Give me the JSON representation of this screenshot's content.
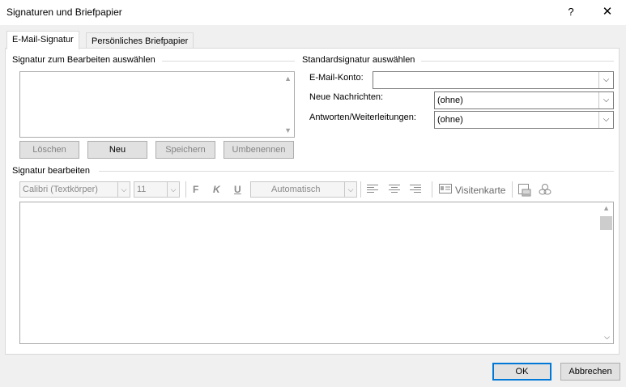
{
  "window": {
    "title": "Signaturen und Briefpapier",
    "help": "?",
    "close": "✕"
  },
  "tabs": [
    {
      "label": "E-Mail-Signatur",
      "active": true
    },
    {
      "label": "Persönliches Briefpapier",
      "active": false
    }
  ],
  "select_signature": {
    "label": "Signatur zum Bearbeiten auswählen",
    "buttons": {
      "delete": "Löschen",
      "new": "Neu",
      "save": "Speichern",
      "rename": "Umbenennen"
    }
  },
  "default_signature": {
    "label": "Standardsignatur auswählen",
    "account_label": "E-Mail-Konto:",
    "account_value": "",
    "new_messages_label": "Neue Nachrichten:",
    "new_messages_value": "(ohne)",
    "replies_label": "Antworten/Weiterleitungen:",
    "replies_value": "(ohne)"
  },
  "edit_signature": {
    "label": "Signatur bearbeiten",
    "font_value": "Calibri (Textkörper)",
    "size_value": "11",
    "bold": "F",
    "italic": "K",
    "underline": "U",
    "color_value": "Automatisch",
    "business_card": "Visitenkarte"
  },
  "footer": {
    "ok": "OK",
    "cancel": "Abbrechen"
  },
  "icons": [
    "help-icon",
    "close-icon",
    "scroll-up-icon",
    "scroll-down-icon",
    "chevron-down-icon",
    "align-left-icon",
    "align-center-icon",
    "align-right-icon",
    "business-card-icon",
    "insert-picture-icon",
    "hyperlink-icon"
  ],
  "colors": {
    "accent": "#0078d7"
  }
}
